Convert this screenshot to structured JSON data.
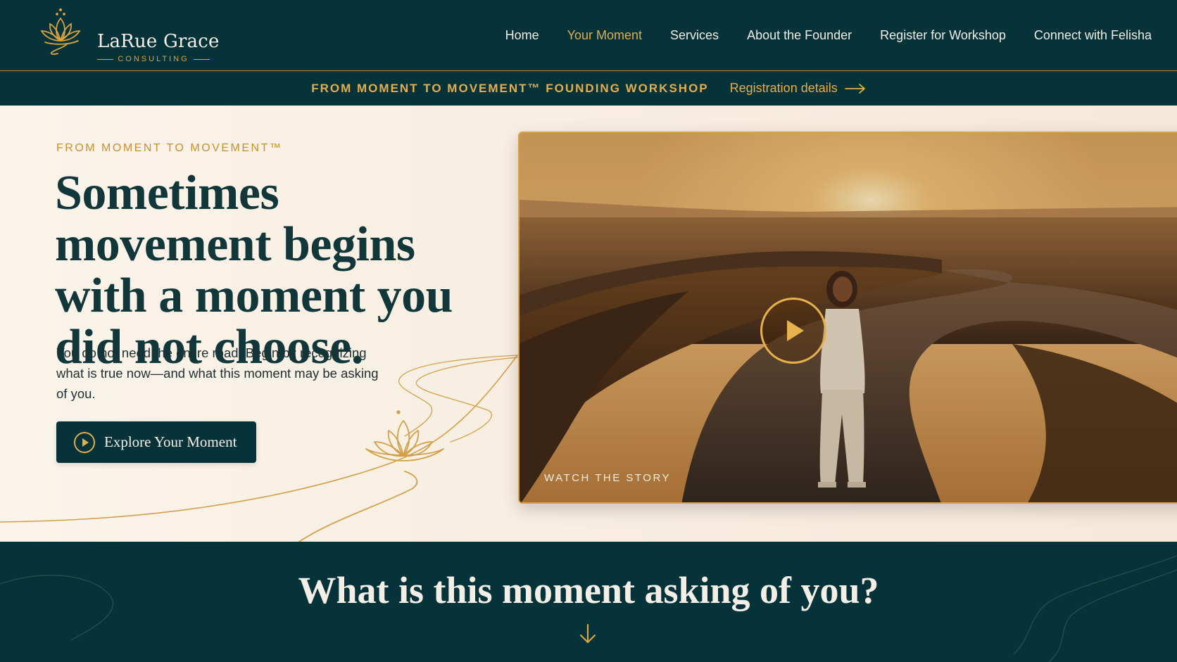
{
  "brand": {
    "name": "LaRue Grace",
    "subtitle": "CONSULTING",
    "icon": "lotus-logo-icon"
  },
  "nav": {
    "items": [
      {
        "label": "Home",
        "active": false
      },
      {
        "label": "Your Moment",
        "active": true
      },
      {
        "label": "Services",
        "active": false
      },
      {
        "label": "About the Founder",
        "active": false
      },
      {
        "label": "Register for Workshop",
        "active": false
      },
      {
        "label": "Connect with Felisha",
        "active": false
      }
    ]
  },
  "announcement": {
    "title": "FROM MOMENT TO MOVEMENT™ FOUNDING WORKSHOP",
    "link_label": "Registration details",
    "link_icon": "arrow-right-icon"
  },
  "hero": {
    "eyebrow": "FROM MOMENT TO MOVEMENT™",
    "headline": "Sometimes movement begins with a moment you did not choose.",
    "body": "You do not need the entire road. Begin by recognizing what is true now—and what this moment may be asking of you.",
    "cta_label": "Explore Your Moment",
    "cta_icon": "play-circle-icon"
  },
  "video": {
    "caption": "WATCH THE STORY",
    "play_icon": "play-icon"
  },
  "section": {
    "title": "What is this moment asking of you?",
    "arrow_icon": "arrow-down-icon"
  },
  "colors": {
    "primary": "#06333a",
    "accent": "#d9a441",
    "background": "#f8efe3",
    "headline": "#12373b"
  }
}
